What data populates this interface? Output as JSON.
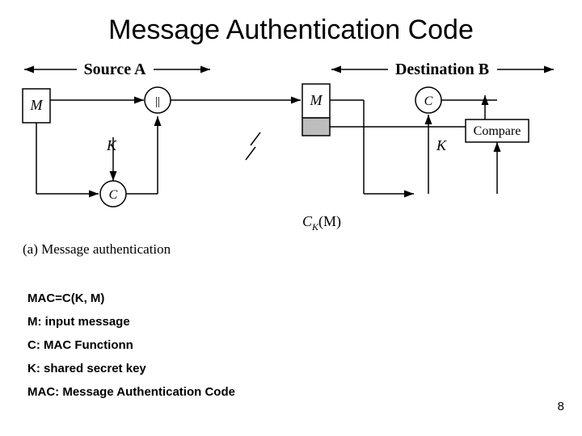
{
  "title": "Message Authentication Code",
  "diagram": {
    "source_label": "Source A",
    "dest_label": "Destination B",
    "M": "M",
    "K": "K",
    "C": "C",
    "concat": "||",
    "compare": "Compare",
    "ck_label": "C",
    "ck_sub": "K",
    "ck_arg": "(M)",
    "caption": "(a) Message authentication"
  },
  "defs": {
    "eq": "MAC=C(K, M)",
    "m": "M: input message",
    "c": "C: MAC Functionn",
    "k": "K: shared secret key",
    "mac": "MAC: Message Authentication Code"
  },
  "page": "8"
}
